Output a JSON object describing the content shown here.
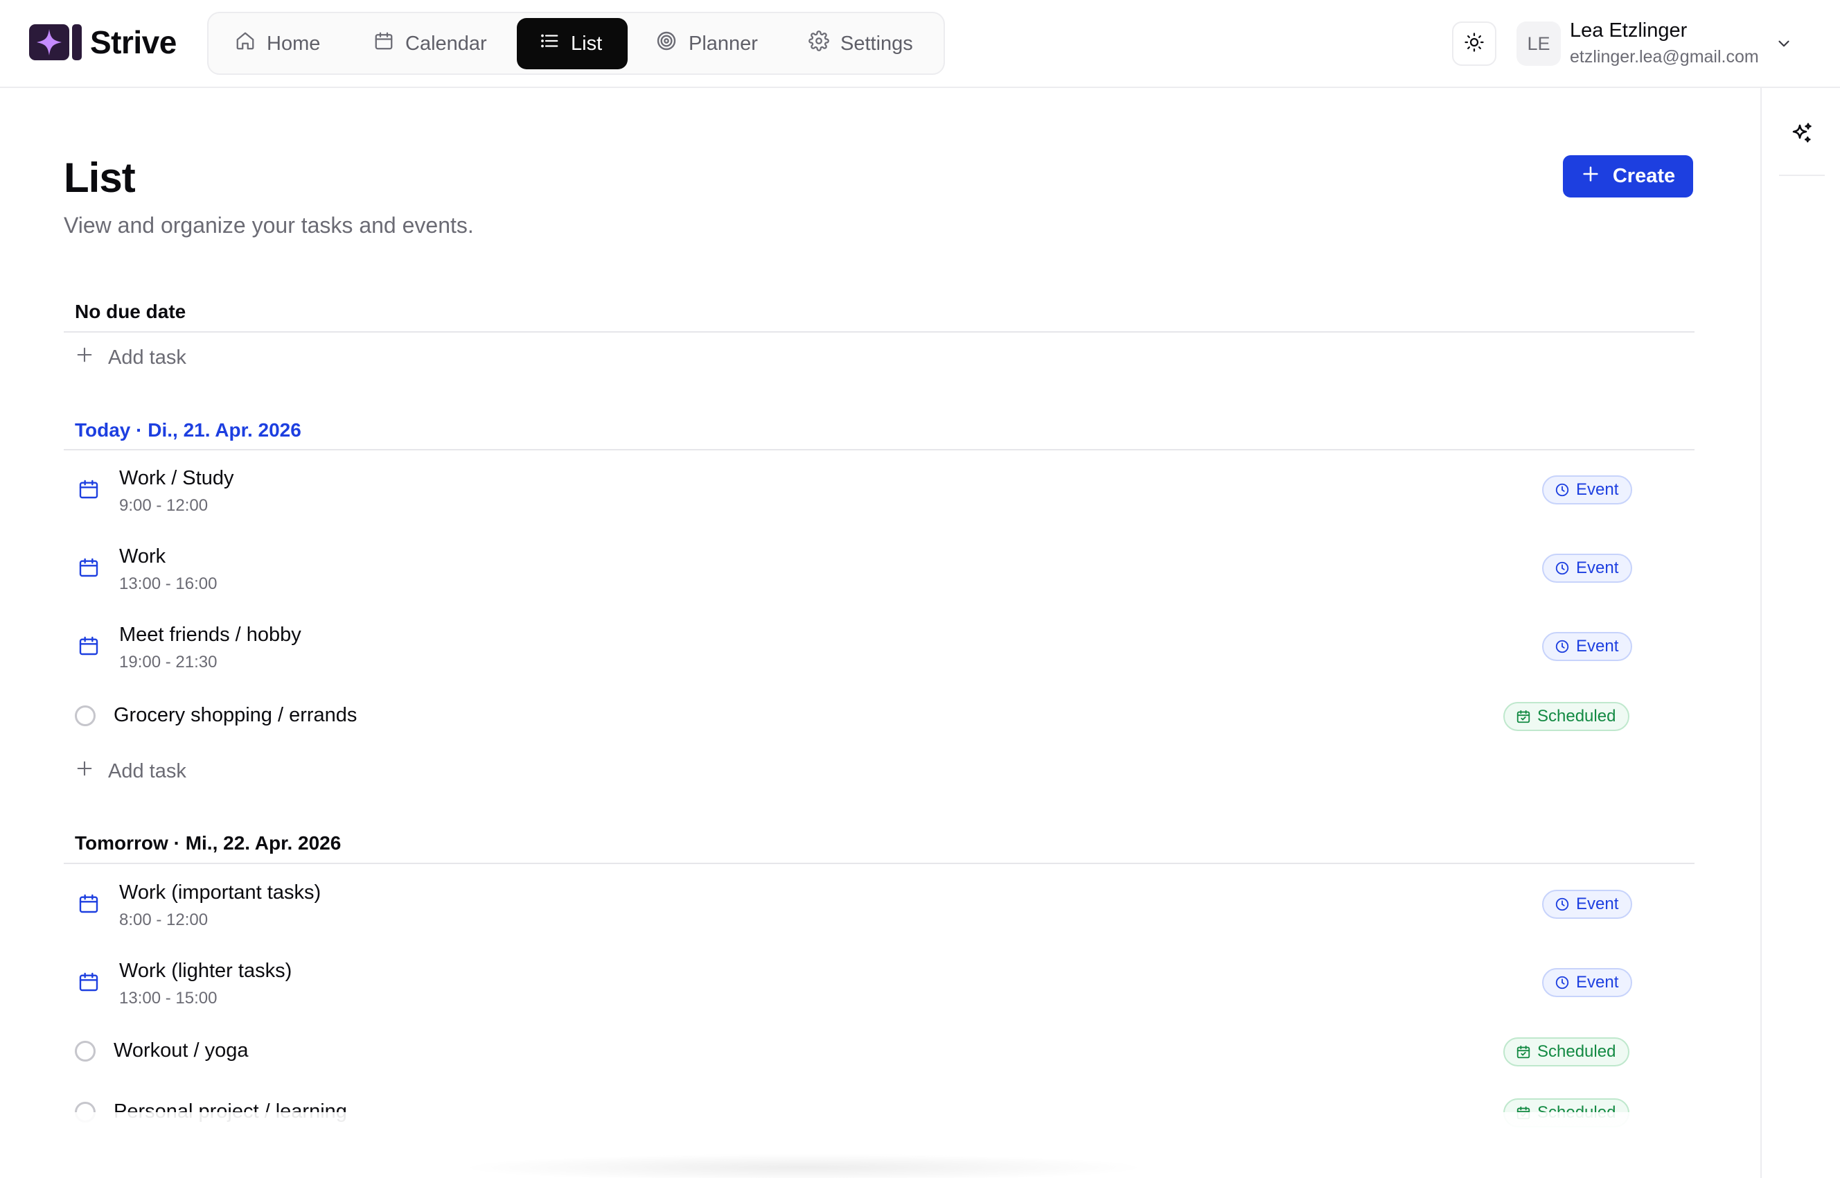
{
  "brand": {
    "name": "Strive",
    "logo_icon": "sparkle-icon",
    "logo_color": "#2b1a3a"
  },
  "nav": {
    "items": [
      {
        "label": "Home",
        "icon": "home-icon",
        "active": false
      },
      {
        "label": "Calendar",
        "icon": "calendar-icon",
        "active": false
      },
      {
        "label": "List",
        "icon": "list-icon",
        "active": true
      },
      {
        "label": "Planner",
        "icon": "target-icon",
        "active": false
      },
      {
        "label": "Settings",
        "icon": "gear-icon",
        "active": false
      }
    ]
  },
  "user": {
    "initials": "LE",
    "name": "Lea Etzlinger",
    "email": "etzlinger.lea@gmail.com"
  },
  "page": {
    "title": "List",
    "subtitle": "View and organize your tasks and events.",
    "create_label": "Create"
  },
  "colors": {
    "accent": "#1d3fe0",
    "event": "#1d3fe0",
    "scheduled": "#138a43"
  },
  "sections": [
    {
      "title": "No due date",
      "add_label": "Add task",
      "items": []
    },
    {
      "title": "Today · Di., 21. Apr. 2026",
      "add_label": "Add task",
      "items": [
        {
          "kind": "event",
          "title": "Work / Study",
          "time": "9:00 - 12:00",
          "badge": "Event"
        },
        {
          "kind": "event",
          "title": "Work",
          "time": "13:00 - 16:00",
          "badge": "Event"
        },
        {
          "kind": "event",
          "title": "Meet friends / hobby",
          "time": "19:00 - 21:30",
          "badge": "Event"
        },
        {
          "kind": "task",
          "title": "Grocery shopping / errands",
          "badge": "Scheduled"
        }
      ]
    },
    {
      "title": "Tomorrow · Mi., 22. Apr. 2026",
      "items": [
        {
          "kind": "event",
          "title": "Work (important tasks)",
          "time": "8:00 - 12:00",
          "badge": "Event"
        },
        {
          "kind": "event",
          "title": "Work (lighter tasks)",
          "time": "13:00 - 15:00",
          "badge": "Event"
        },
        {
          "kind": "task",
          "title": "Workout / yoga",
          "badge": "Scheduled"
        },
        {
          "kind": "task",
          "title": "Personal project / learning",
          "badge": "Scheduled"
        }
      ]
    }
  ]
}
